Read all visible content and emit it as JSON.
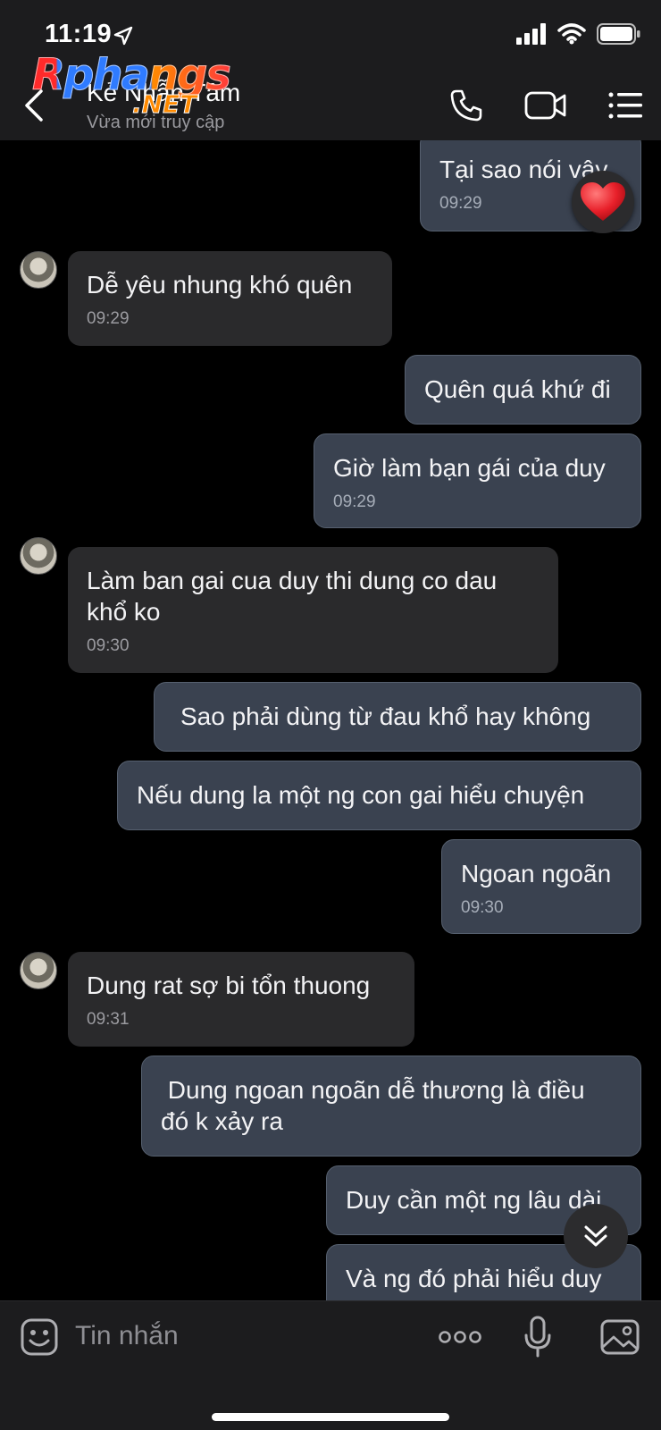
{
  "status_bar": {
    "time": "11:19"
  },
  "header": {
    "contact_name": "Kẻ Nhẫn Tâm",
    "contact_status": "Vừa mới truy cập",
    "watermark_main": "Rphangs",
    "watermark_sub": ".NET"
  },
  "messages": [
    {
      "dir": "out",
      "text": "Tại sao nói vậy",
      "time": "09:29"
    },
    {
      "dir": "in",
      "text": "Dễ yêu nhung khó quên",
      "time": "09:29"
    },
    {
      "dir": "out",
      "text": "Quên quá khứ đi",
      "time": ""
    },
    {
      "dir": "out",
      "text": "Giờ làm bạn gái của duy",
      "time": "09:29"
    },
    {
      "dir": "in",
      "text_line1": "Làm ban gai cua duy thi dung co dau",
      "text_line2": "khổ ko",
      "time": "09:30"
    },
    {
      "dir": "out",
      "text": "Sao phải dùng từ đau khổ hay không",
      "time": ""
    },
    {
      "dir": "out",
      "text": "Nếu dung la một ng con gai hiểu chuyện",
      "time": ""
    },
    {
      "dir": "out",
      "text": "Ngoan ngoãn",
      "time": "09:30"
    },
    {
      "dir": "in",
      "text": "Dung rat sợ bi tổn thuong",
      "time": "09:31"
    },
    {
      "dir": "out",
      "text_line1": " Dung ngoan ngoãn dễ thương là điều",
      "text_line2": "đó k xảy ra",
      "time": ""
    },
    {
      "dir": "out",
      "text": "Duy cần một ng lâu dài",
      "time": ""
    },
    {
      "dir": "out",
      "text": "Và ng đó phải hiểu duy",
      "time": ""
    }
  ],
  "input": {
    "placeholder": "Tin nhắn"
  },
  "colors": {
    "outgoing_bubble": "#3a4250",
    "incoming_bubble": "#2a2a2c",
    "background": "#000000",
    "bar": "#1c1c1e"
  }
}
